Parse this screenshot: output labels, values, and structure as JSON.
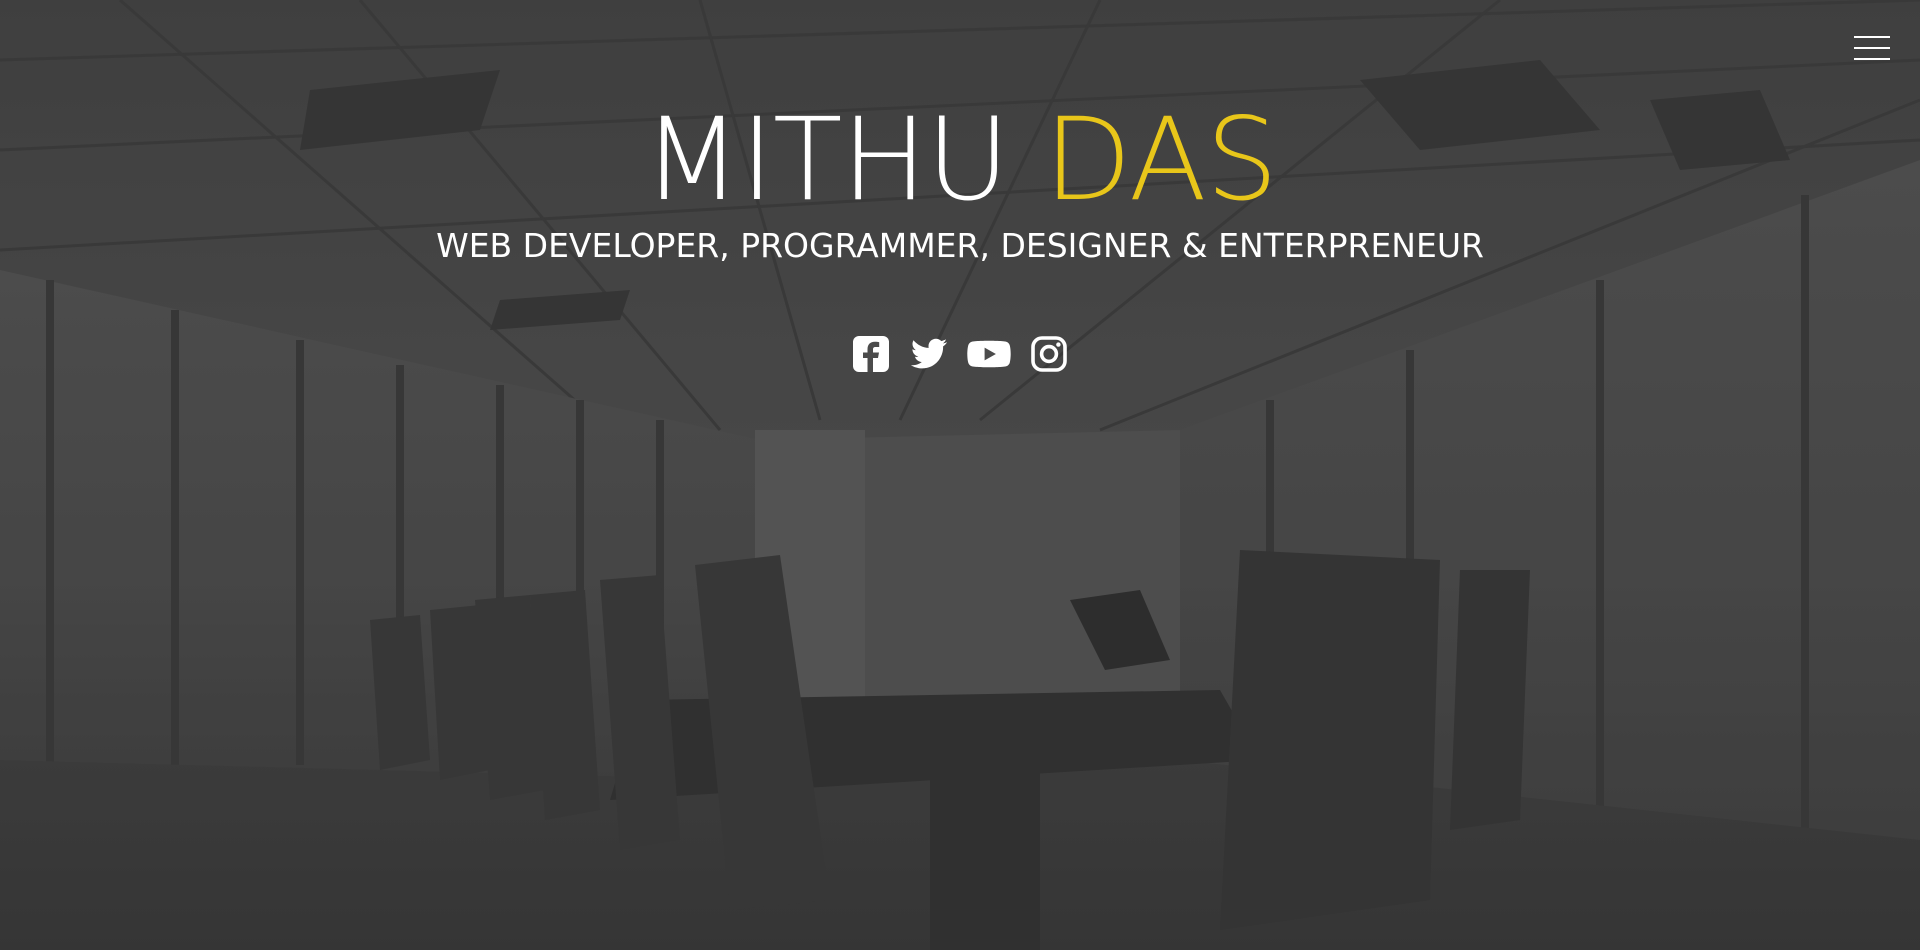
{
  "hero": {
    "name_first": "MITHU",
    "name_last": "DAS",
    "tagline": "WEB DEVELOPER, PROGRAMMER, DESIGNER & ENTERPRENEUR",
    "accent_color": "#e8c61a",
    "background_image": "dim conference-room-icon"
  },
  "menu": {
    "icon": "hamburger-icon"
  },
  "social": [
    {
      "icon": "facebook-icon"
    },
    {
      "icon": "twitter-icon"
    },
    {
      "icon": "youtube-icon"
    },
    {
      "icon": "instagram-icon"
    }
  ]
}
